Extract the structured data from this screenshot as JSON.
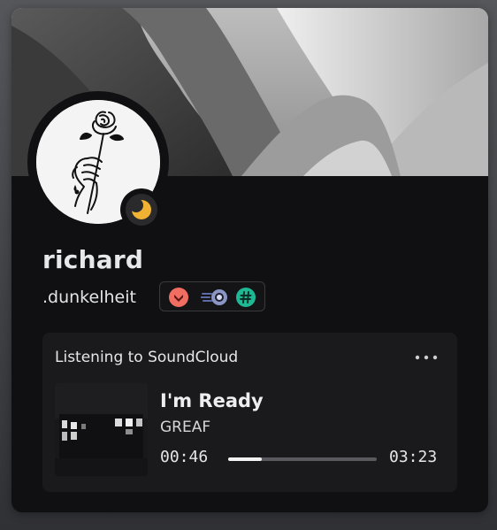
{
  "profile": {
    "username": "richard",
    "handle": ".dunkelheit",
    "status": "idle",
    "status_color": "#f0b232",
    "badges": [
      {
        "icon": "chevron-down-badge-icon",
        "color": "#f06d62"
      },
      {
        "icon": "speed-orb-badge-icon",
        "color": "#8a95c4"
      },
      {
        "icon": "hashtag-badge-icon",
        "color": "#1fb894"
      }
    ]
  },
  "activity": {
    "header": "Listening to SoundCloud",
    "more_icon": "more-horizontal-icon",
    "track_title": "I'm Ready",
    "artist": "GREAF",
    "elapsed": "00:46",
    "total": "03:23",
    "progress": 0.2266
  },
  "colors": {
    "card_background": "#101012",
    "activity_background": "#1a1a1c",
    "text_primary": "#e7e8ea"
  }
}
